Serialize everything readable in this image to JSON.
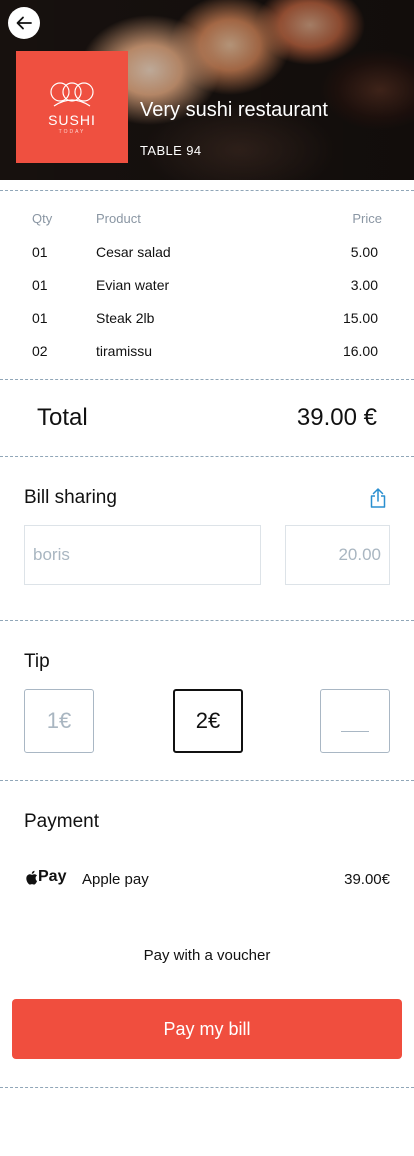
{
  "header": {
    "logo_text": "SUSHI",
    "logo_subtext": "TODAY",
    "restaurant_name": "Very sushi restaurant",
    "table": "TABLE 94"
  },
  "bill": {
    "columns": {
      "qty": "Qty",
      "product": "Product",
      "price": "Price"
    },
    "items": [
      {
        "qty": "01",
        "product": "Cesar salad",
        "price": "5.00"
      },
      {
        "qty": "01",
        "product": "Evian water",
        "price": "3.00"
      },
      {
        "qty": "01",
        "product": "Steak 2lb",
        "price": "15.00"
      },
      {
        "qty": "02",
        "product": "tiramissu",
        "price": "16.00"
      }
    ],
    "total_label": "Total",
    "total_value": "39.00 €"
  },
  "sharing": {
    "title": "Bill sharing",
    "name_placeholder": "boris",
    "amount_placeholder": "20.00"
  },
  "tip": {
    "title": "Tip",
    "options": [
      "1€",
      "2€",
      ""
    ],
    "selected": "2€"
  },
  "payment": {
    "title": "Payment",
    "apple_pay_logo": "Pay",
    "method": "Apple pay",
    "amount": "39.00€",
    "voucher": "Pay with a voucher",
    "pay_button": "Pay my bill"
  },
  "colors": {
    "accent": "#f04e3e",
    "divider": "#90a6b8",
    "muted": "#8a96a3",
    "share_icon": "#2a8fd0"
  }
}
